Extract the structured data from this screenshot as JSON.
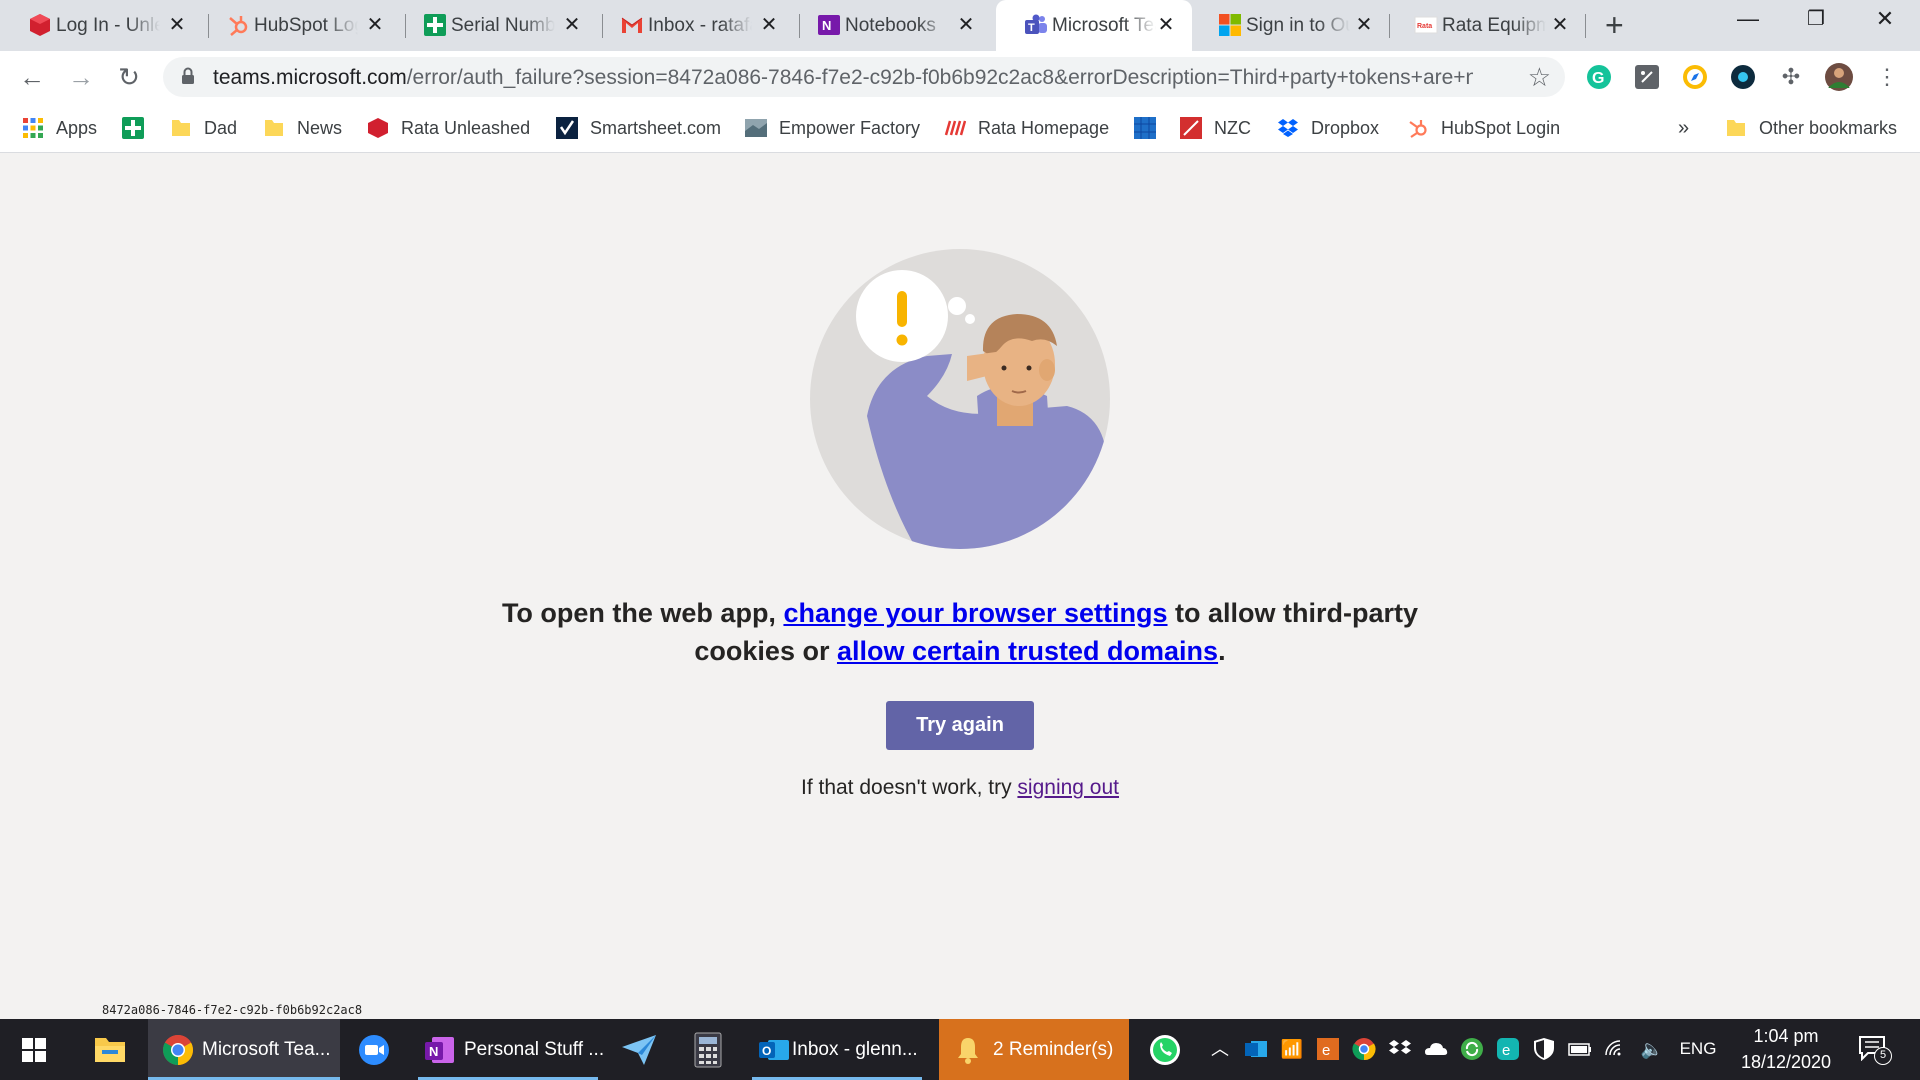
{
  "browser": {
    "tabs": [
      {
        "title": "Log In - Unleashed",
        "icon": "unleashed-icon"
      },
      {
        "title": "HubSpot Login",
        "icon": "hubspot-icon"
      },
      {
        "title": "Serial Numbers",
        "icon": "smartsheet-plus-icon"
      },
      {
        "title": "Inbox - ratafactory",
        "icon": "gmail-icon"
      },
      {
        "title": "Notebooks",
        "icon": "onenote-icon"
      },
      {
        "title": "Microsoft Teams",
        "icon": "teams-icon",
        "active": true
      },
      {
        "title": "Sign in to Outlook",
        "icon": "microsoft-icon"
      },
      {
        "title": "Rata Equipment",
        "icon": "rata-icon"
      }
    ],
    "url_host": "teams.microsoft.com",
    "url_rest": "/error/auth_failure?session=8472a086-7846-f7e2-c92b-f0b6b92c2ac8&errorDescription=Third+party+tokens+are+n...",
    "bookmarks": [
      {
        "label": "Apps"
      },
      {
        "label": ""
      },
      {
        "label": "Dad"
      },
      {
        "label": "News"
      },
      {
        "label": "Rata Unleashed"
      },
      {
        "label": "Smartsheet.com"
      },
      {
        "label": "Empower Factory"
      },
      {
        "label": "Rata Homepage"
      },
      {
        "label": ""
      },
      {
        "label": "NZC"
      },
      {
        "label": "Dropbox"
      },
      {
        "label": "HubSpot Login"
      }
    ],
    "more_bookmarks": "»",
    "other_bookmarks": "Other bookmarks"
  },
  "page": {
    "message_part1": "To open the web app, ",
    "link_browser_settings": "change your browser settings",
    "message_part2": " to allow third-party cookies or ",
    "link_trusted_domains": "allow certain trusted domains",
    "message_part3": ".",
    "try_again": "Try again",
    "fallback_text": "If that doesn't work, try ",
    "link_sign_out": "signing out",
    "session_id": "8472a086-7846-f7e2-c92b-f0b6b92c2ac8"
  },
  "colors": {
    "teams_purple": "#6264a7",
    "page_bg": "#f3f2f1",
    "link_blue": "#0000ee",
    "outlook_highlight": "#d7711d"
  },
  "taskbar": {
    "chrome": "Microsoft Tea...",
    "onenote": "Personal Stuff ...",
    "outlook": "Inbox - glenn...",
    "reminders": "2 Reminder(s)",
    "language": "ENG",
    "time": "1:04 pm",
    "date": "18/12/2020",
    "notifications": "5"
  }
}
